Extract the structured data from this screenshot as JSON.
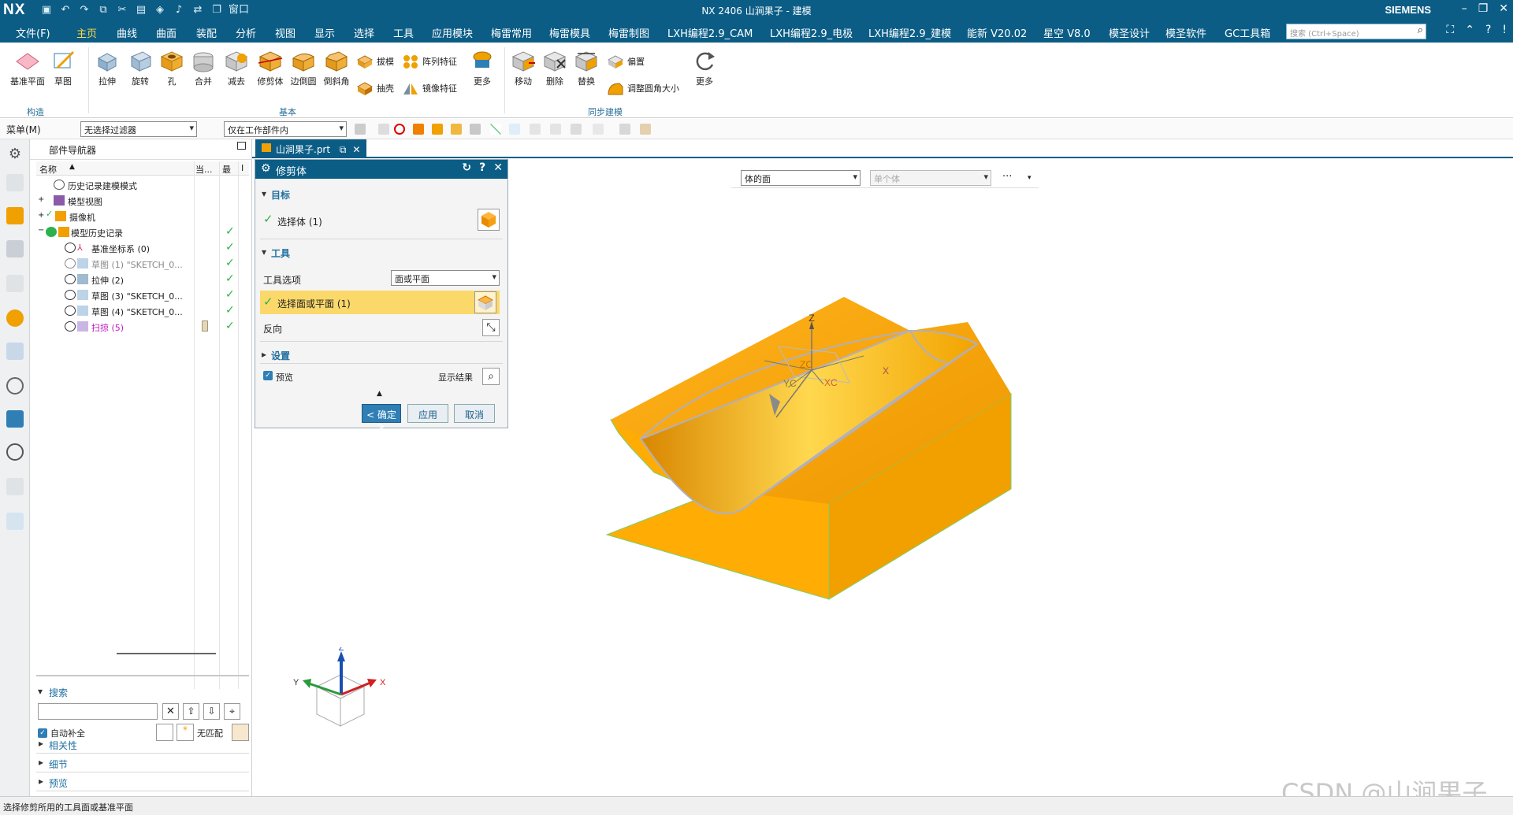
{
  "app": {
    "logo": "NX",
    "window_title": "NX 2406  山涧果子 - 建模",
    "brand": "SIEMENS"
  },
  "menubar": {
    "file": "文件(F)",
    "tabs": [
      "主页",
      "曲线",
      "曲面",
      "装配",
      "分析",
      "视图",
      "显示",
      "选择",
      "工具",
      "应用模块",
      "梅雷常用",
      "梅雷模具",
      "梅雷制图",
      "LXH编程2.9_CAM",
      "LXH编程2.9_电极",
      "LXH编程2.9_建模",
      "能新 V20.02",
      "星空 V8.0",
      "模圣设计",
      "模圣软件",
      "GC工具箱"
    ],
    "active_tab": "主页",
    "search_placeholder": "搜索 (Ctrl+Space)",
    "window_menu": "窗口"
  },
  "ribbon": {
    "construct": {
      "items": [
        "基准平面",
        "草图"
      ],
      "group_label": "构造"
    },
    "basic": {
      "items": [
        "拉伸",
        "旋转",
        "孔",
        "合并",
        "减去",
        "修剪体",
        "边倒圆",
        "倒斜角"
      ],
      "small_items": [
        "拔模",
        "阵列特征",
        "抽壳",
        "镜像特征"
      ],
      "more": "更多",
      "group_label": "基本"
    },
    "sync": {
      "items": [
        "移动",
        "删除",
        "替换"
      ],
      "small_items": [
        "偏置",
        "调整圆角大小"
      ],
      "more": "更多",
      "group_label": "同步建模"
    }
  },
  "toolbar": {
    "menu": "菜单(M)",
    "filter": "无选择过滤器",
    "scope": "仅在工作部件内"
  },
  "navigator": {
    "title": "部件导航器",
    "columns": [
      "名称",
      "当...",
      "最",
      "I"
    ],
    "rows": [
      {
        "label": "历史记录建模模式",
        "indent": 0,
        "check": false
      },
      {
        "label": "模型视图",
        "indent": 0,
        "check": false
      },
      {
        "label": "摄像机",
        "indent": 0,
        "check": false
      },
      {
        "label": "模型历史记录",
        "indent": 0,
        "check": true
      },
      {
        "label": "基准坐标系 (0)",
        "indent": 1,
        "check": true
      },
      {
        "label": "草图 (1) \"SKETCH_0...",
        "indent": 1,
        "check": true
      },
      {
        "label": "拉伸 (2)",
        "indent": 1,
        "check": true
      },
      {
        "label": "草图 (3) \"SKETCH_0...",
        "indent": 1,
        "check": true
      },
      {
        "label": "草图 (4) \"SKETCH_0...",
        "indent": 1,
        "check": true
      },
      {
        "label": "扫掠 (5)",
        "indent": 1,
        "check": true
      }
    ],
    "search": {
      "title": "搜索",
      "auto_complete": "自动补全",
      "no_match": "无匹配"
    },
    "sections": [
      "相关性",
      "细节",
      "预览"
    ]
  },
  "part_tab": "山涧果子.prt",
  "viewbar": {
    "type_filter": "体的面",
    "scope": "单个体",
    "more": "···"
  },
  "dialog": {
    "title": "修剪体",
    "target_section": "目标",
    "target_select": "选择体 (1)",
    "tool_section": "工具",
    "tool_option_label": "工具选项",
    "tool_option_value": "面或平面",
    "tool_select": "选择面或平面 (1)",
    "reverse": "反向",
    "settings": "设置",
    "preview": "预览",
    "show_result": "显示结果",
    "ok": "< 确定 >",
    "apply": "应用",
    "cancel": "取消"
  },
  "model_labels": {
    "z": "Z",
    "zc": "ZC",
    "yc": "YC",
    "xc": "XC",
    "x": "X"
  },
  "triad": {
    "z": "Z",
    "y": "Y",
    "x": "X"
  },
  "status_text": "选择修剪所用的工具面或基准平面",
  "watermark": "CSDN @山涧果子",
  "colors": {
    "accent": "#0b5d86",
    "body": "#f6a500",
    "check": "#2bb24c"
  }
}
